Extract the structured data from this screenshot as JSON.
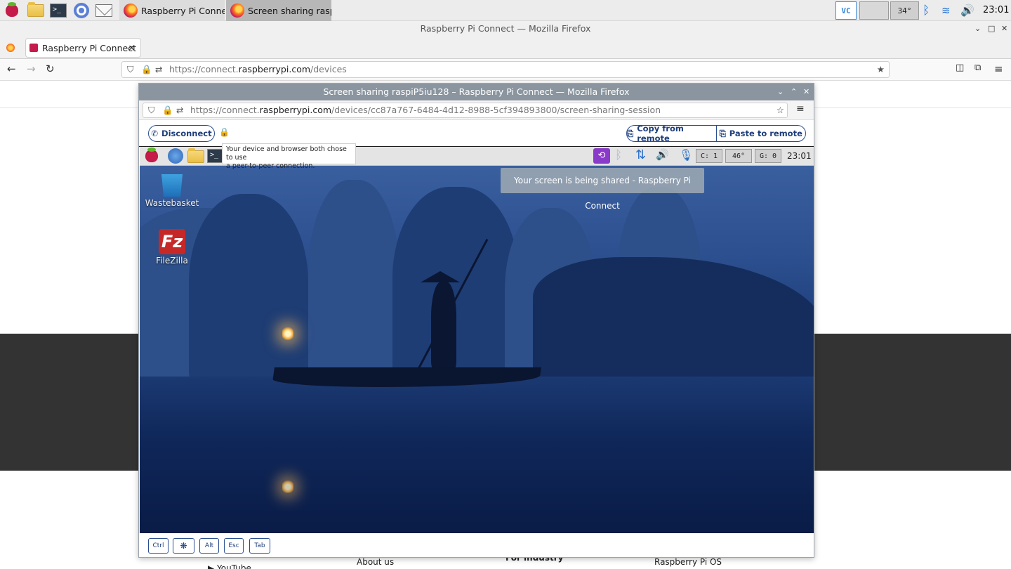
{
  "taskbar": {
    "tasks": [
      {
        "label": "Raspberry Pi Connec..."
      },
      {
        "label": "Screen sharing raspi..."
      }
    ],
    "cpu_temp": "34°",
    "clock": "23:01"
  },
  "host_window": {
    "title": "Raspberry Pi Connect — Mozilla Firefox",
    "tab_label": "Raspberry Pi Connect",
    "url_prefix": "https://connect.",
    "url_domain": "raspberrypi.com",
    "url_path": "/devices"
  },
  "host_page": {
    "footer": {
      "youtube": "YouTube",
      "about": "About us",
      "industry": "For industry",
      "os": "Raspberry Pi OS"
    }
  },
  "popup": {
    "title": "Screen sharing raspiP5iu128 – Raspberry Pi Connect — Mozilla Firefox",
    "url_prefix": "https://connect.",
    "url_domain": "raspberrypi.com",
    "url_path": "/devices/cc87a767-6484-4d12-8988-5cf394893800/screen-sharing-session",
    "disconnect_label": "Disconnect",
    "copy_label": "Copy from remote",
    "paste_label": "Paste to remote",
    "tooltip_line1": "Your device and browser both chose to use",
    "tooltip_line2": "a peer-to-peer connection."
  },
  "remote": {
    "panel": {
      "cpu": "C: 1",
      "temp": "46°",
      "gpu": "G: 0",
      "clock": "23:01"
    },
    "notification": "Your screen is being shared - Raspberry Pi Connect",
    "icons": [
      {
        "label": "Wastebasket"
      },
      {
        "label": "FileZilla"
      }
    ],
    "fz_glyph": "Fz"
  },
  "keys": {
    "ctrl": "Ctrl",
    "alt": "Alt",
    "esc": "Esc",
    "tab": "Tab"
  }
}
